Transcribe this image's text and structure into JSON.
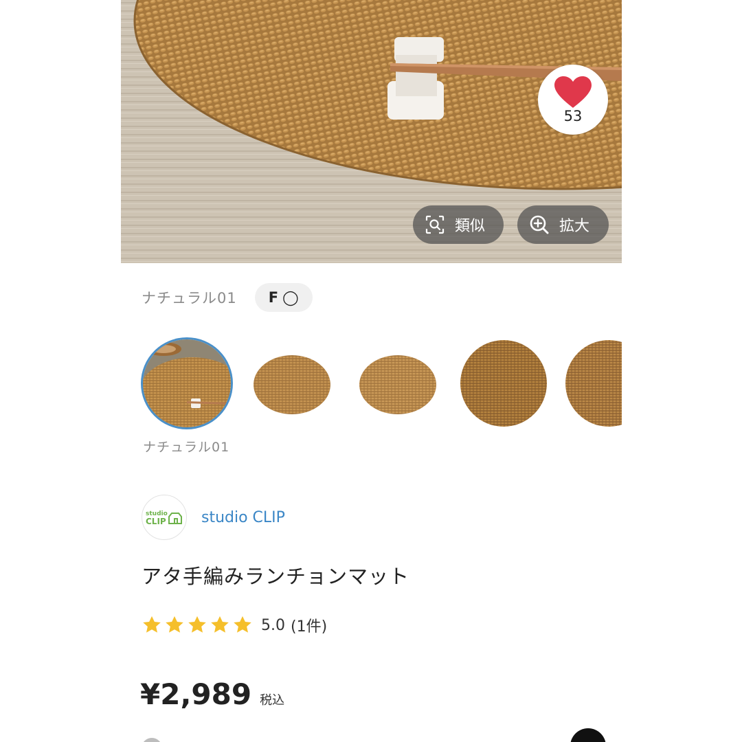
{
  "product": {
    "like_count": "53",
    "similar_label": "類似",
    "zoom_label": "拡大",
    "color_label": "ナチュラル01",
    "size_label_bold": "F",
    "size_label_mark": "◯",
    "thumbnails": [
      {
        "caption": "ナチュラル01",
        "selected": true
      },
      {
        "caption": "",
        "selected": false
      },
      {
        "caption": "",
        "selected": false
      },
      {
        "caption": "",
        "selected": false
      },
      {
        "caption": "",
        "selected": false
      }
    ],
    "shop_name": "studio CLIP",
    "shop_logo_text_top": "studio",
    "shop_logo_text_bottom": "CLIP",
    "title": "アタ手編みランチョンマット",
    "rating_value": "5.0",
    "rating_count": "(1件)",
    "rating_stars": 5,
    "price": "¥2,989",
    "tax_label": "税込"
  },
  "colors": {
    "heart": "#e0384b",
    "link": "#3a86c6",
    "star": "#f5bf2b",
    "selected_ring": "#4a90c9",
    "shop_logo": "#6db24a"
  }
}
